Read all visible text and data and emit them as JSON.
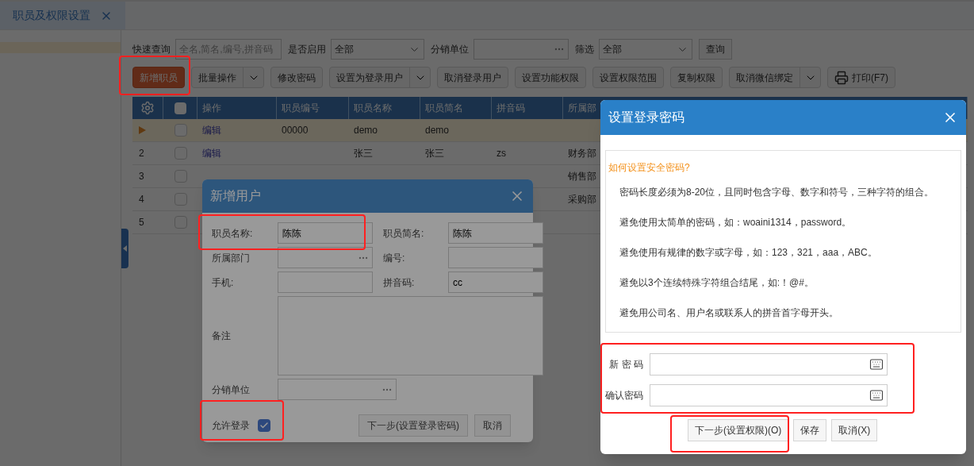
{
  "tab": {
    "label": "职员及权限设置",
    "selected": true
  },
  "filters": [
    {
      "kind": "text",
      "label": "快速查询",
      "placeholder": "全名,简名,编号,拼音码"
    },
    {
      "kind": "select",
      "label": "是否启用",
      "value": "全部"
    },
    {
      "kind": "picker",
      "label": "分销单位"
    },
    {
      "kind": "select",
      "label": "筛选",
      "value": "全部"
    }
  ],
  "query_button": "查询",
  "toolbar": [
    {
      "kind": "primary",
      "label": "新增职员"
    },
    {
      "kind": "split",
      "label": "批量操作"
    },
    {
      "kind": "plain",
      "label": "修改密码"
    },
    {
      "kind": "split",
      "label": "设置为登录用户"
    },
    {
      "kind": "plain",
      "label": "取消登录用户"
    },
    {
      "kind": "plain",
      "label": "设置功能权限"
    },
    {
      "kind": "plain",
      "label": "设置权限范围"
    },
    {
      "kind": "plain",
      "label": "复制权限"
    },
    {
      "kind": "split",
      "label": "取消微信绑定"
    },
    {
      "kind": "print",
      "label": "打印(F7)"
    }
  ],
  "table": {
    "header_checked": false,
    "columns": [
      "操作",
      "职员编号",
      "职员名称",
      "职员简名",
      "拼音码",
      "所属部"
    ],
    "rows": [
      {
        "selected": true,
        "checked": false,
        "cells": [
          "编辑",
          "00000",
          "demo",
          "demo",
          null,
          null
        ]
      },
      {
        "number": "2",
        "selected": false,
        "checked": false,
        "cells": [
          "编辑",
          null,
          "张三",
          "张三",
          "zs",
          "财务部"
        ]
      },
      {
        "number": "3",
        "selected": false,
        "checked": false,
        "cells": [
          null,
          null,
          null,
          null,
          null,
          "销售部"
        ]
      },
      {
        "number": "4",
        "selected": false,
        "checked": false,
        "cells": [
          null,
          null,
          null,
          null,
          null,
          "采购部"
        ]
      },
      {
        "number": "5",
        "selected": false,
        "checked": false,
        "cells": [
          null,
          null,
          null,
          null,
          null,
          null
        ]
      }
    ]
  },
  "add_user_dialog": {
    "title": "新增用户",
    "fields": [
      {
        "kind": "text",
        "label": "职员名称:",
        "value": "陈陈"
      },
      {
        "kind": "text",
        "label": "职员简名:",
        "value": "陈陈"
      },
      {
        "kind": "picker",
        "label": "所属部门"
      },
      {
        "kind": "text",
        "label": "编号:"
      },
      {
        "kind": "text",
        "label": "手机:"
      },
      {
        "kind": "text",
        "label": "拼音码:",
        "value": "cc"
      },
      {
        "kind": "textarea",
        "label": "备注"
      },
      {
        "kind": "picker",
        "label": "分销单位"
      }
    ],
    "allow_login": {
      "label": "允许登录",
      "checked": true
    },
    "buttons": [
      "下一步(设置登录密码)",
      "取消"
    ]
  },
  "password_dialog": {
    "title": "设置登录密码",
    "tips_title": "如何设置安全密码?",
    "tips": [
      "密码长度必须为8-20位，且同时包含字母、数字和符号，三种字符的组合。",
      "避免使用太简单的密码，如：woaini1314，password。",
      "避免使用有规律的数字或字母，如：123，321，aaa，ABC。",
      "避免以3个连续特殊字符组合结尾，如:！@#。",
      "避免用公司名、用户名或联系人的拼音首字母开头。"
    ],
    "fields": [
      {
        "label": "新 密 码"
      },
      {
        "label": "确认密码"
      }
    ],
    "buttons": [
      "下一步(设置权限)(O)",
      "保存",
      "取消(X)"
    ]
  }
}
